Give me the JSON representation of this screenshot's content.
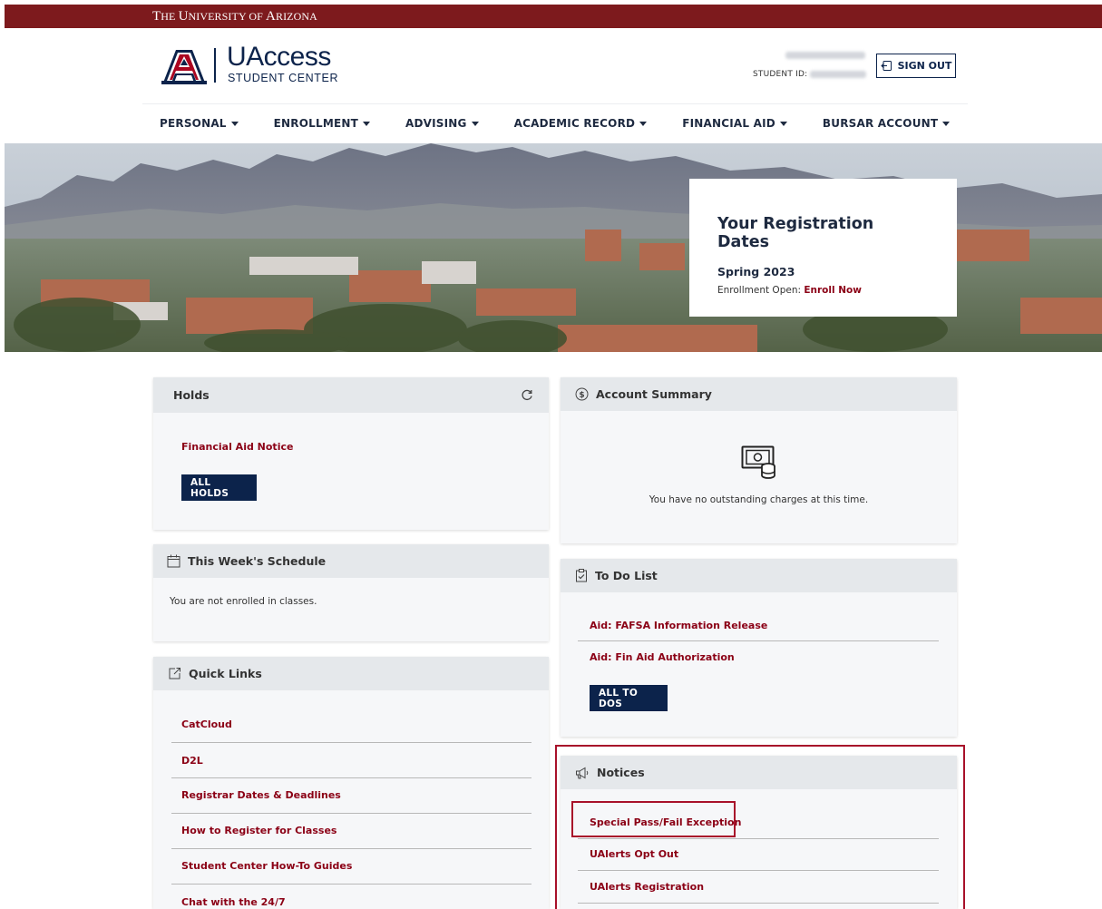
{
  "topbar": {
    "university_prefix": "T",
    "university_rest_1": "HE ",
    "university_u": "U",
    "university_rest_2": "NIVERSITY OF ",
    "university_a": "A",
    "university_rest_3": "RIZONA"
  },
  "header": {
    "app_title": "UAccess",
    "app_subtitle": "STUDENT CENTER",
    "student_id_label": "STUDENT ID:",
    "signout_label": "SIGN OUT"
  },
  "nav": {
    "items": [
      "PERSONAL",
      "ENROLLMENT",
      "ADVISING",
      "ACADEMIC RECORD",
      "FINANCIAL AID",
      "BURSAR ACCOUNT"
    ]
  },
  "registration": {
    "title": "Your Registration Dates",
    "term": "Spring 2023",
    "open_label": "Enrollment Open: ",
    "open_link": "Enroll Now"
  },
  "holds": {
    "title": "Holds",
    "items": [
      "Financial Aid Notice"
    ],
    "button": "ALL HOLDS"
  },
  "account": {
    "title": "Account Summary",
    "message": "You have no outstanding charges at this time."
  },
  "schedule": {
    "title": "This Week's Schedule",
    "message": "You are not enrolled in classes."
  },
  "todo": {
    "title": "To Do List",
    "items": [
      "Aid: FAFSA Information Release",
      "Aid: Fin Aid Authorization"
    ],
    "button": "ALL TO DOS"
  },
  "quicklinks": {
    "title": "Quick Links",
    "items": [
      "CatCloud",
      "D2L",
      "Registrar Dates & Deadlines",
      "How to Register for Classes",
      "Student Center How-To Guides",
      "Chat with the 24/7"
    ]
  },
  "notices": {
    "title": "Notices",
    "items": [
      "Special Pass/Fail Exception",
      "UAlerts Opt Out",
      "UAlerts Registration"
    ]
  },
  "colors": {
    "brand_red": "#7d1a1d",
    "navy": "#0c234b",
    "link_red": "#8b0015",
    "highlight_red": "#a8112a"
  }
}
